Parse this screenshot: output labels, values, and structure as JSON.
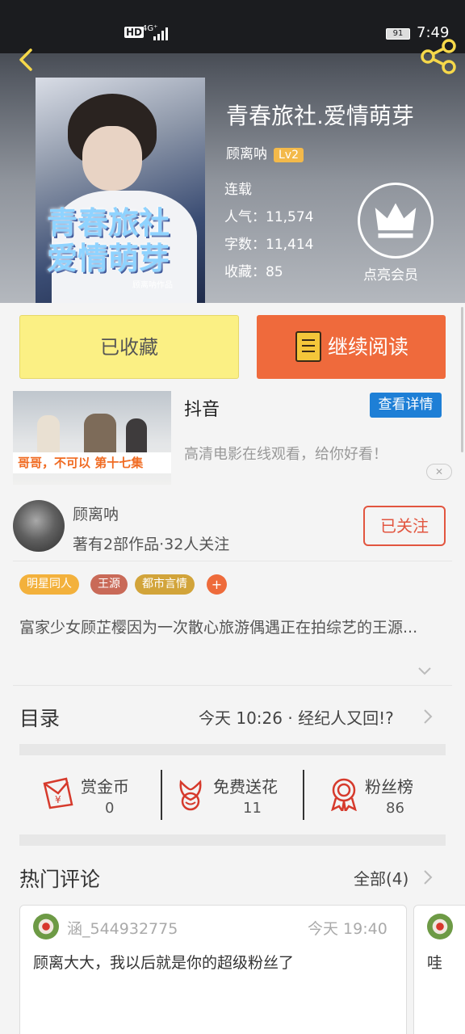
{
  "status_bar": {
    "hd": "HD",
    "network": "4G⁺",
    "battery": "91",
    "time": "7:49"
  },
  "book": {
    "title": "青春旅社.爱情萌芽",
    "cover_text": "青春旅社\n爱情萌芽",
    "cover_author": "顾离呐作品",
    "author": "顾离呐",
    "level": "Lv2",
    "status": "连载",
    "popularity": "人气：11,574",
    "word_count": "字数：11,414",
    "favorites": "收藏：85",
    "vip_label": "点亮会员"
  },
  "actions": {
    "favorited": "已收藏",
    "continue_reading": "继续阅读"
  },
  "ad": {
    "image_caption": "哥哥，不可以 第十七集",
    "title": "抖音",
    "detail_button": "查看详情",
    "description": "高清电影在线观看，给你好看！",
    "close": "✕"
  },
  "author_info": {
    "name": "顾离呐",
    "stats": "著有2部作品·32人关注",
    "follow_button": "已关注"
  },
  "tags": [
    {
      "label": "明星同人",
      "color": "#f3b13c"
    },
    {
      "label": "王源",
      "color": "#c96a58"
    },
    {
      "label": "都市言情",
      "color": "#d2a43a"
    }
  ],
  "tag_add": "+",
  "synopsis": "富家少女顾芷樱因为一次散心旅游偶遇正在拍综艺的王源...",
  "catalog": {
    "label": "目录",
    "latest": "今天 10:26 · 经纪人又回!?"
  },
  "stats": [
    {
      "label": "赏金币",
      "value": "0",
      "icon": "red-envelope-icon"
    },
    {
      "label": "免费送花",
      "value": "11",
      "icon": "flower-icon"
    },
    {
      "label": "粉丝榜",
      "value": "86",
      "icon": "medal-icon"
    }
  ],
  "comments": {
    "label": "热门评论",
    "all": "全部(4)",
    "items": [
      {
        "user": "涵_544932775",
        "time": "今天 19:40",
        "text": "顾离大大，我以后就是你的超级粉丝了"
      },
      {
        "user": "",
        "time": "",
        "text": "哇"
      }
    ]
  },
  "colors": {
    "accent_orange": "#ef6a3c",
    "favorite_yellow": "#fbf084",
    "detail_blue": "#1e7fd6",
    "follow_red": "#e2553f"
  }
}
